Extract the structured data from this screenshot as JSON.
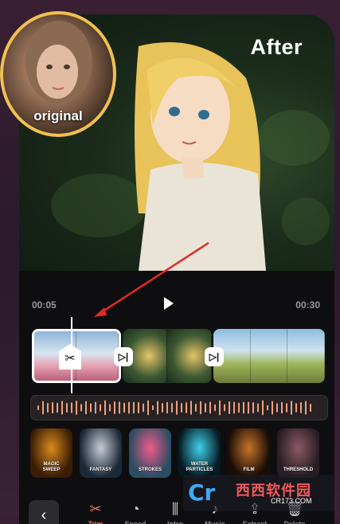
{
  "preview": {
    "after_label": "After",
    "original_label": "original"
  },
  "timeline": {
    "time_start": "00:05",
    "time_end": "00:30"
  },
  "effects": [
    {
      "name": "MAGIC\nSWEEP",
      "color1": "#3a1d05",
      "color2": "#d98a1d"
    },
    {
      "name": "FANTASY",
      "color1": "#1b2838",
      "color2": "#c9cdd6"
    },
    {
      "name": "STROKES",
      "color1": "#2a4d63",
      "color2": "#f05b8b"
    },
    {
      "name": "WATER\nPARTICLES",
      "color1": "#061a24",
      "color2": "#3fd1e8"
    },
    {
      "name": "FILM",
      "color1": "#1a0d06",
      "color2": "#c8742a"
    },
    {
      "name": "THRESHOLD",
      "color1": "#2a1d24",
      "color2": "#8a5a64"
    }
  ],
  "toolbar": {
    "back_icon": "chevron-left-icon",
    "tools": [
      {
        "label": "Trim",
        "icon": "scissors-icon"
      },
      {
        "label": "Speed",
        "icon": "speedometer-icon"
      },
      {
        "label": "Intro",
        "icon": "intro-icon"
      },
      {
        "label": "Music",
        "icon": "music-icon"
      },
      {
        "label": "Extract",
        "icon": "extract-icon"
      },
      {
        "label": "Delete",
        "icon": "delete-icon"
      }
    ]
  },
  "watermark": {
    "logo": "Cr",
    "text": "西西软件园",
    "sub": "CR173.COM"
  },
  "colors": {
    "accent": "#f4765e",
    "ring": "#f0c050"
  }
}
